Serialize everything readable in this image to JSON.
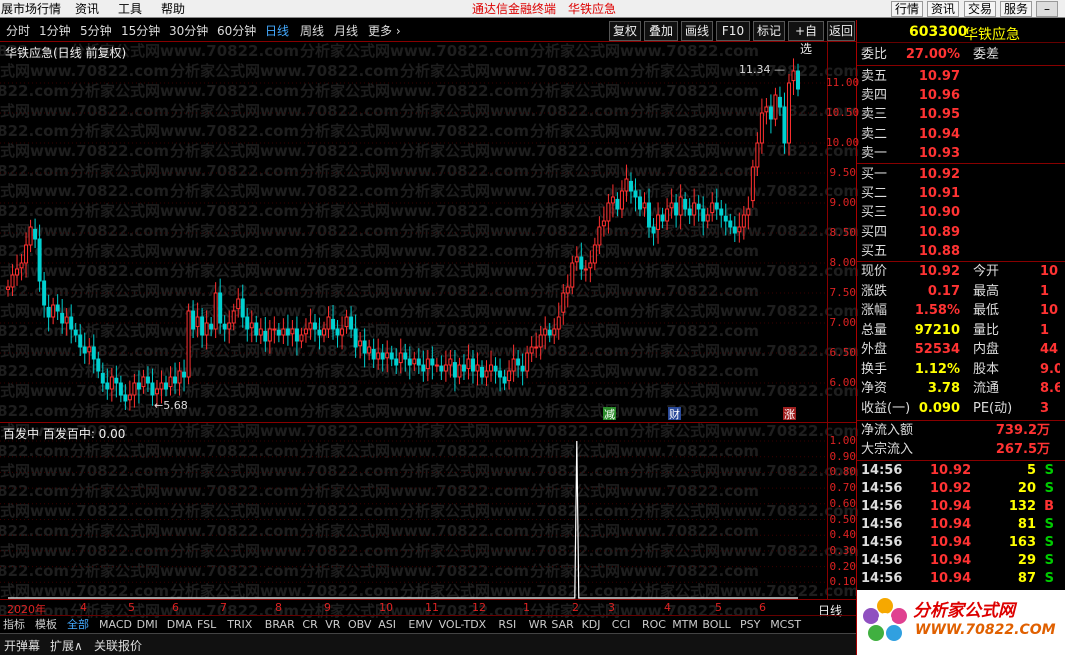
{
  "menu": {
    "items": [
      "展市场行情",
      "资讯",
      "工具",
      "帮助"
    ],
    "center_title": "通达信金融终端",
    "center_stock": "华铁应急",
    "right_buttons": [
      "行情",
      "资讯",
      "交易",
      "服务"
    ]
  },
  "periods": [
    "分时",
    "1分钟",
    "5分钟",
    "15分钟",
    "30分钟",
    "60分钟",
    "日线",
    "周线",
    "月线",
    "更多 ›"
  ],
  "active_period": "日线",
  "toolbar": [
    "复权",
    "叠加",
    "画线",
    "F10",
    "标记",
    "+自选",
    "返回"
  ],
  "chart_title": "华铁应急(日线 前复权)",
  "price_max_label": "11.34",
  "price_min_label": "5.68",
  "markers": {
    "reduce": "减",
    "finance": "财",
    "rise": "涨"
  },
  "sub_title": "百发中  百发百中: 0.00",
  "watermark": "分析家公式网www.70822.com",
  "right_quote": {
    "code": "603300",
    "name": "华铁应急",
    "weibi": {
      "label": "委比",
      "value": "27.00%",
      "label2": "委差"
    },
    "sell": [
      {
        "label": "卖五",
        "price": "10.97"
      },
      {
        "label": "卖四",
        "price": "10.96"
      },
      {
        "label": "卖三",
        "price": "10.95"
      },
      {
        "label": "卖二",
        "price": "10.94"
      },
      {
        "label": "卖一",
        "price": "10.93"
      }
    ],
    "buy": [
      {
        "label": "买一",
        "price": "10.92"
      },
      {
        "label": "买二",
        "price": "10.91"
      },
      {
        "label": "买三",
        "price": "10.90"
      },
      {
        "label": "买四",
        "price": "10.89"
      },
      {
        "label": "买五",
        "price": "10.88"
      }
    ],
    "stats": [
      {
        "l": "现价",
        "v": "10.92",
        "c": "#f33",
        "l2": "今开",
        "v2": "10"
      },
      {
        "l": "涨跌",
        "v": "0.17",
        "c": "#f33",
        "l2": "最高",
        "v2": "1"
      },
      {
        "l": "涨幅",
        "v": "1.58%",
        "c": "#f33",
        "l2": "最低",
        "v2": "10"
      },
      {
        "l": "总量",
        "v": "97210",
        "c": "#ff0",
        "l2": "量比",
        "v2": "1"
      },
      {
        "l": "外盘",
        "v": "52534",
        "c": "#f33",
        "l2": "内盘",
        "v2": "44"
      },
      {
        "l": "换手",
        "v": "1.12%",
        "c": "#ff0",
        "l2": "股本",
        "v2": "9.0"
      },
      {
        "l": "净资",
        "v": "3.78",
        "c": "#ff0",
        "l2": "流通",
        "v2": "8.6"
      },
      {
        "l": "收益(一)",
        "v": "0.090",
        "c": "#ff0",
        "l2": "PE(动)",
        "v2": "3"
      }
    ],
    "flows": [
      {
        "label": "净流入额",
        "value": "739.2万"
      },
      {
        "label": "大宗流入",
        "value": "267.5万"
      }
    ],
    "ticks": [
      {
        "t": "14:56",
        "p": "10.92",
        "q": "5",
        "d": "S"
      },
      {
        "t": "14:56",
        "p": "10.92",
        "q": "20",
        "d": "S"
      },
      {
        "t": "14:56",
        "p": "10.94",
        "q": "132",
        "d": "B"
      },
      {
        "t": "14:56",
        "p": "10.94",
        "q": "81",
        "d": "S"
      },
      {
        "t": "14:56",
        "p": "10.94",
        "q": "163",
        "d": "S"
      },
      {
        "t": "14:56",
        "p": "10.94",
        "q": "29",
        "d": "S"
      },
      {
        "t": "14:56",
        "p": "10.94",
        "q": "87",
        "d": "S"
      }
    ]
  },
  "indicators": [
    "指标",
    "模板",
    "全部",
    "MACD",
    "DMI",
    "DMA",
    "FSL",
    "TRIX",
    "BRAR",
    "CR",
    "VR",
    "OBV",
    "ASI",
    "EMV",
    "VOL-TDX",
    "RSI",
    "WR",
    "SAR",
    "KDJ",
    "CCI",
    "ROC",
    "MTM",
    "BOLL",
    "PSY",
    "MCST"
  ],
  "active_indicator": "全部",
  "bottom_tabs": [
    "开弹幕",
    "扩展∧",
    "关联报价"
  ],
  "period_label_bottom": "日线",
  "logo": {
    "text": "分析家公式网",
    "url": "WWW.70822.COM"
  },
  "colors": {
    "up": "#ff3030",
    "down": "#00d0d0",
    "axis": "#800000",
    "label": "#dd2222"
  },
  "chart_data": {
    "type": "candlestick",
    "y_ticks": [
      6.0,
      6.5,
      7.0,
      7.5,
      8.0,
      8.5,
      9.0,
      9.5,
      10.0,
      10.5,
      11.0
    ],
    "x_labels": [
      "2020年",
      "4",
      "5",
      "6",
      "7",
      "8",
      "9",
      "10",
      "11",
      "12",
      "1",
      "2",
      "3",
      "4",
      "5",
      "6"
    ],
    "closes": [
      7.6,
      7.8,
      7.9,
      8.0,
      8.3,
      8.6,
      8.4,
      7.7,
      7.3,
      7.1,
      7.3,
      7.2,
      7.0,
      7.1,
      6.9,
      6.8,
      6.6,
      6.5,
      6.6,
      6.4,
      6.2,
      6.0,
      5.9,
      6.1,
      6.0,
      5.8,
      5.7,
      5.8,
      6.0,
      5.9,
      6.1,
      6.0,
      5.8,
      5.9,
      6.0,
      5.9,
      6.1,
      6.0,
      6.2,
      6.1,
      7.2,
      6.9,
      7.1,
      6.8,
      7.0,
      6.9,
      7.5,
      7.0,
      6.9,
      7.0,
      7.2,
      7.4,
      7.1,
      6.9,
      7.0,
      6.8,
      6.9,
      6.7,
      6.9,
      6.9,
      6.8,
      6.9,
      6.8,
      6.9,
      6.7,
      6.8,
      6.9,
      7.0,
      6.9,
      6.8,
      6.9,
      7.1,
      6.9,
      6.8,
      6.9,
      7.1,
      6.9,
      6.6,
      6.7,
      6.5,
      6.6,
      6.4,
      6.5,
      6.4,
      6.5,
      6.4,
      6.3,
      6.5,
      6.4,
      6.3,
      6.4,
      6.3,
      6.2,
      6.4,
      6.3,
      6.3,
      6.2,
      6.3,
      6.4,
      6.1,
      6.3,
      6.2,
      6.4,
      6.2,
      6.3,
      6.1,
      6.2,
      6.3,
      6.2,
      6.1,
      6.0,
      6.2,
      6.4,
      6.3,
      6.2,
      6.5,
      6.6,
      6.6,
      6.8,
      6.9,
      6.8,
      6.9,
      7.1,
      7.5,
      7.6,
      8.0,
      8.1,
      7.9,
      7.9,
      8.0,
      8.3,
      8.6,
      8.7,
      9.0,
      9.1,
      8.9,
      9.2,
      9.4,
      9.2,
      9.1,
      8.9,
      9.0,
      8.6,
      8.5,
      8.8,
      8.7,
      8.9,
      9.0,
      8.8,
      9.1,
      8.9,
      8.8,
      9.0,
      8.9,
      8.7,
      8.8,
      9.0,
      8.9,
      8.8,
      8.7,
      8.6,
      8.5,
      8.6,
      8.8,
      8.9,
      9.6,
      10.0,
      10.5,
      10.6,
      10.4,
      10.8,
      10.6,
      10.0,
      11.0,
      11.2,
      10.9
    ],
    "indicator_spike": {
      "name": "百发百中",
      "index": 126,
      "value": 1.0
    },
    "indicator_y_ticks": [
      0.1,
      0.2,
      0.3,
      0.4,
      0.5,
      0.6,
      0.7,
      0.8,
      0.9,
      1.0
    ],
    "max_label": 11.34,
    "min_label": 5.68
  }
}
